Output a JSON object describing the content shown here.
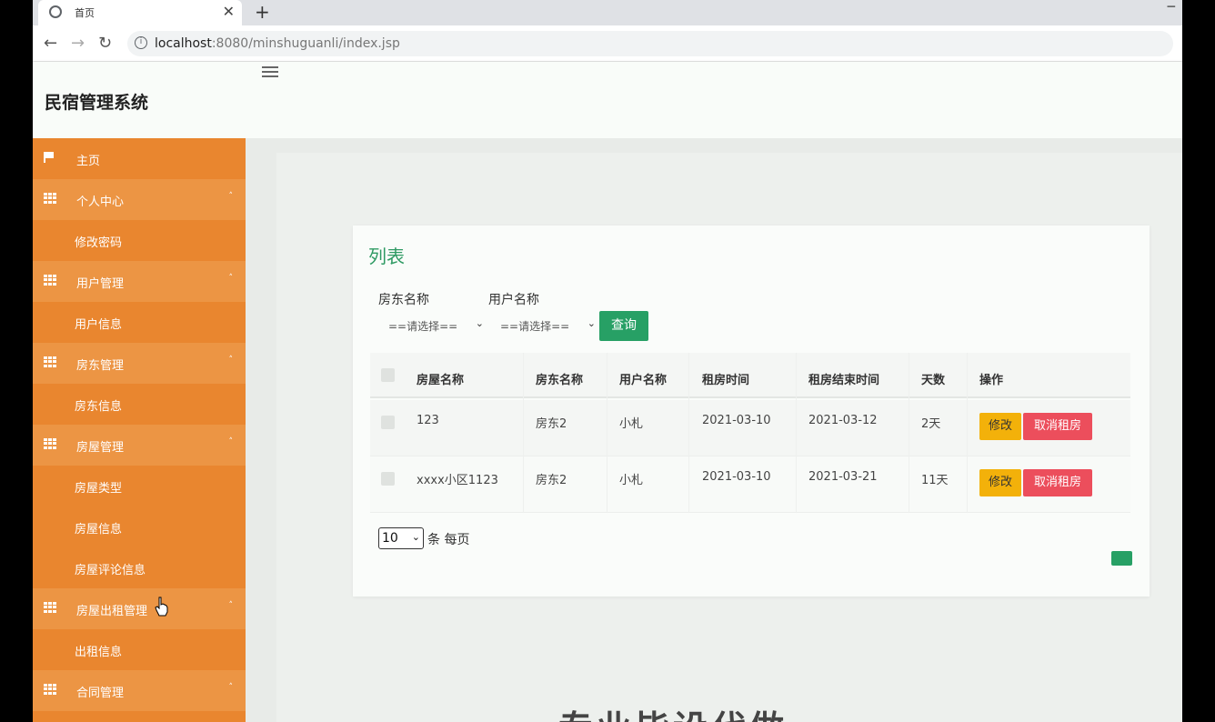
{
  "browser": {
    "tab_title": "首页",
    "tab_close": "✕",
    "new_tab": "+",
    "minimize": "─",
    "url_host": "localhost",
    "url_path": ":8080/minshuguanli/index.jsp",
    "back_icon": "←",
    "forward_icon": "→",
    "reload_icon": "↻"
  },
  "app": {
    "brand": "民宿管理系统"
  },
  "sidebar": {
    "items": [
      {
        "type": "home",
        "label": "主页",
        "icon": "flag-icon"
      },
      {
        "type": "group",
        "label": "个人中心",
        "icon": "grid-icon",
        "arrow": "˄"
      },
      {
        "type": "sub",
        "label": "修改密码"
      },
      {
        "type": "group",
        "label": "用户管理",
        "icon": "grid-icon",
        "arrow": "˄"
      },
      {
        "type": "sub",
        "label": "用户信息"
      },
      {
        "type": "group",
        "label": "房东管理",
        "icon": "grid-icon",
        "arrow": "˄"
      },
      {
        "type": "sub",
        "label": "房东信息"
      },
      {
        "type": "group",
        "label": "房屋管理",
        "icon": "grid-icon",
        "arrow": "˄"
      },
      {
        "type": "sub",
        "label": "房屋类型"
      },
      {
        "type": "sub",
        "label": "房屋信息"
      },
      {
        "type": "sub",
        "label": "房屋评论信息"
      },
      {
        "type": "group",
        "label": "房屋出租管理",
        "icon": "grid-icon",
        "arrow": "˄"
      },
      {
        "type": "sub",
        "label": "出租信息"
      },
      {
        "type": "group",
        "label": "合同管理",
        "icon": "grid-icon",
        "arrow": "˄"
      }
    ]
  },
  "main": {
    "card_title": "列表",
    "filters": {
      "landlord_label": "房东名称",
      "landlord_value": "==请选择==",
      "user_label": "用户名称",
      "user_value": "==请选择==",
      "search_button": "查询"
    },
    "table": {
      "headers": [
        "房屋名称",
        "房东名称",
        "用户名称",
        "租房时间",
        "租房结束时间",
        "天数",
        "操作"
      ],
      "rows": [
        {
          "house": "123",
          "landlord": "房东2",
          "user": "小札",
          "start": "2021-03-10",
          "end": "2021-03-12",
          "days": "2天",
          "edit": "修改",
          "cancel": "取消租房"
        },
        {
          "house": "xxxx小区1123",
          "landlord": "房东2",
          "user": "小札",
          "start": "2021-03-10",
          "end": "2021-03-21",
          "days": "11天",
          "edit": "修改",
          "cancel": "取消租房"
        }
      ]
    },
    "pagination": {
      "page_size": "10",
      "page_size_label": "条 每页"
    },
    "watermark": "专业毕设代做"
  },
  "colors": {
    "sidebar": "#e9862f",
    "accent_green": "#27a065",
    "edit_button": "#f3b10a",
    "cancel_button": "#ec4e5c"
  }
}
